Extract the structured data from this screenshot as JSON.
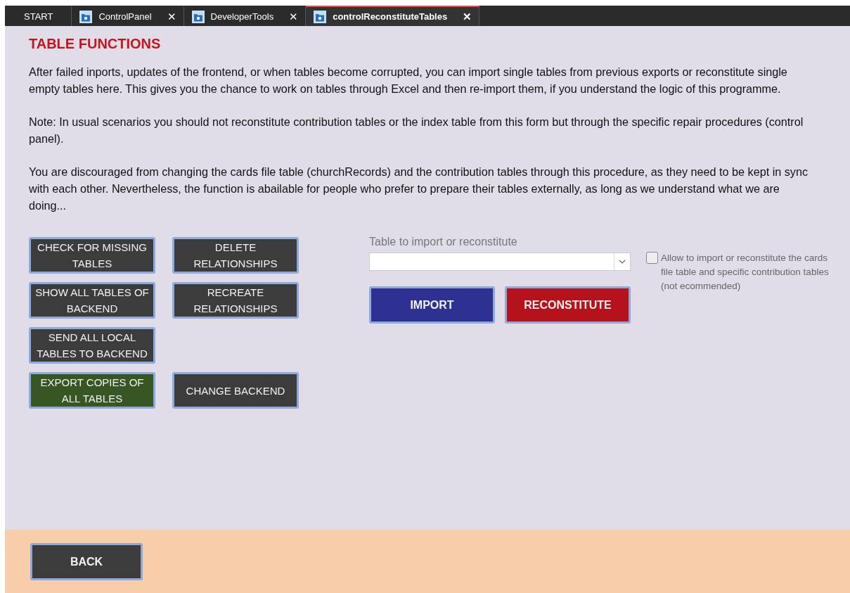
{
  "tabs": [
    {
      "label": "START",
      "selected": false,
      "closable": false
    },
    {
      "label": "ControlPanel",
      "selected": false,
      "closable": true
    },
    {
      "label": "DeveloperTools",
      "selected": false,
      "closable": true
    },
    {
      "label": "controlReconstituteTables",
      "selected": true,
      "closable": true
    }
  ],
  "close_glyph": "✕",
  "title": "TABLE FUNCTIONS",
  "paragraphs": [
    "After failed inports, updates of the frontend, or when tables become corrupted, you can import single tables from previous exports or reconstitute single empty tables here. This gives you the chance to work on tables through Excel and then re-import them, if you understand the logic of this programme.",
    "Note: In usual scenarios you should not reconstitute contribution tables or the index table from this form but through the specific repair procedures (control panel).",
    "You are  discouraged from changing the cards file table (churchRecords) and the contribution tables through this procedure, as they need to be kept in sync with each other. Nevertheless, the function is abailable for people who prefer to prepare their tables externally, as long as we understand what we are doing..."
  ],
  "left_buttons": [
    {
      "label": "CHECK FOR MISSING TABLES",
      "color": "#3c3c3c"
    },
    {
      "label": "SHOW ALL TABLES OF BACKEND",
      "color": "#3c3c3c"
    },
    {
      "label": "SEND ALL LOCAL TABLES TO BACKEND",
      "color": "#3c3c3c"
    },
    {
      "label": "EXPORT COPIES OF ALL TABLES",
      "color": "#375623"
    }
  ],
  "right_buttons": [
    {
      "label": "DELETE RELATIONSHIPS",
      "color": "#3c3c3c"
    },
    {
      "label": "RECREATE RELATIONSHIPS",
      "color": "#3c3c3c"
    },
    {
      "label": "CHANGE BACKEND",
      "color": "#3c3c3c"
    }
  ],
  "table_select": {
    "label": "Table to import or reconstitute"
  },
  "action_buttons": [
    {
      "label": "IMPORT",
      "color": "#2e3192"
    },
    {
      "label": "RECONSTITUTE",
      "color": "#b5121b"
    }
  ],
  "allow_checkbox": {
    "label": "Allow to import or reconstitute the cards file table and specific contribution tables (not ecommended)",
    "checked": false
  },
  "footer": {
    "back_button": "BACK"
  }
}
